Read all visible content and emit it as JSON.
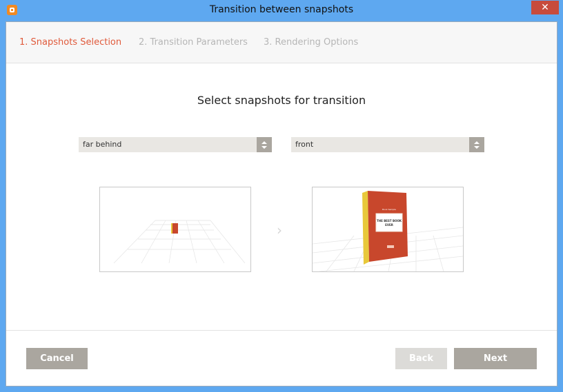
{
  "window": {
    "title": "Transition between snapshots",
    "close_glyph": "✕"
  },
  "steps": [
    {
      "label": "1. Snapshots Selection",
      "active": true
    },
    {
      "label": "2. Transition Parameters",
      "active": false
    },
    {
      "label": "3. Rendering Options",
      "active": false
    }
  ],
  "main": {
    "heading": "Select snapshots for transition",
    "from_select": {
      "value": "far behind"
    },
    "to_select": {
      "value": "front"
    },
    "arrow_glyph": "›",
    "book_text": {
      "small": "Book Sample",
      "title_line1": "THE BEST BOOK",
      "title_line2": "EVER"
    }
  },
  "buttons": {
    "cancel": "Cancel",
    "back": "Back",
    "next": "Next"
  },
  "colors": {
    "accent": "#e05a3b",
    "button": "#aaa69f",
    "button_disabled": "#dcdbd8",
    "titlebar": "#5ea8f0",
    "close": "#c74b3c"
  }
}
